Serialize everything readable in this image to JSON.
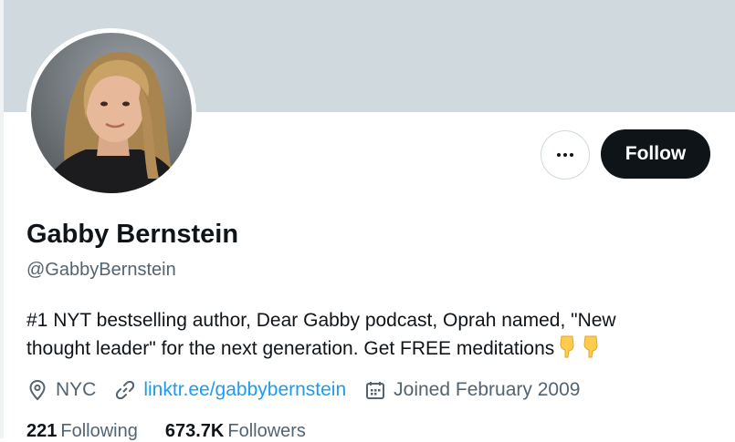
{
  "profile": {
    "name": "Gabby Bernstein",
    "handle": "@GabbyBernstein",
    "bio_line1": "#1 NYT bestselling author, Dear Gabby podcast, Oprah named, \"New",
    "bio_line2": "thought leader\" for the next generation. Get FREE meditations",
    "location": "NYC",
    "link": "linktr.ee/gabbybernstein",
    "joined": "Joined February 2009"
  },
  "actions": {
    "follow_label": "Follow"
  },
  "stats": {
    "following_count": "221",
    "following_label": "Following",
    "followers_count": "673.7K",
    "followers_label": "Followers"
  },
  "colors": {
    "banner": "#cfd9de",
    "text_primary": "#0f1419",
    "text_secondary": "#536471",
    "link": "#1d9bf0",
    "follow_bg": "#0f1419"
  },
  "icons": {
    "location": "location-pin-icon",
    "link": "link-icon",
    "calendar": "calendar-icon",
    "more": "more-dots-icon",
    "emoji": "pointing-down-hand-emoji"
  }
}
